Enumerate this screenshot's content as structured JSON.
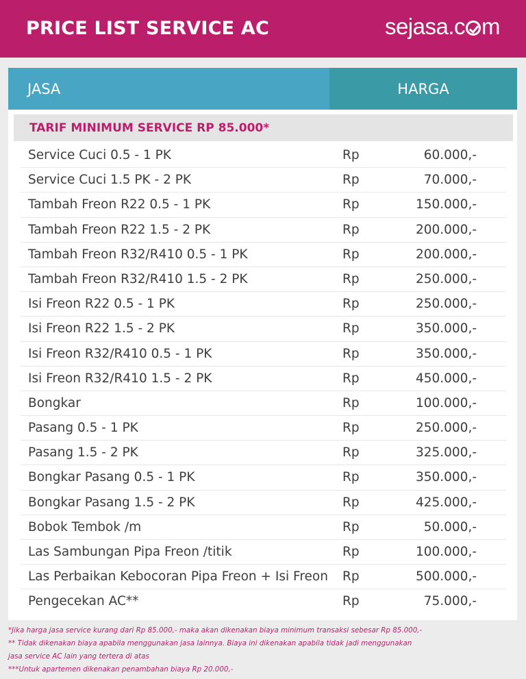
{
  "header": {
    "title": "PRICE LIST SERVICE AC",
    "logo_prefix": "sejasa.c",
    "logo_suffix": "m"
  },
  "table": {
    "col_jasa": "JASA",
    "col_harga": "HARGA",
    "tarif_minimum": "TARIF MINIMUM SERVICE RP 85.000*",
    "currency": "Rp",
    "rows": [
      {
        "name": "Service Cuci 0.5 - 1 PK",
        "price": "60.000,-"
      },
      {
        "name": "Service Cuci 1.5 PK - 2 PK",
        "price": "70.000,-"
      },
      {
        "name": "Tambah Freon R22 0.5 - 1 PK",
        "price": "150.000,-"
      },
      {
        "name": "Tambah Freon R22 1.5 - 2 PK",
        "price": "200.000,-"
      },
      {
        "name": "Tambah Freon R32/R410 0.5 - 1 PK",
        "price": "200.000,-"
      },
      {
        "name": "Tambah Freon R32/R410 1.5 - 2 PK",
        "price": "250.000,-"
      },
      {
        "name": "Isi Freon R22 0.5 - 1 PK",
        "price": "250.000,-"
      },
      {
        "name": "Isi Freon R22 1.5 - 2 PK",
        "price": "350.000,-"
      },
      {
        "name": "Isi Freon R32/R410 0.5 - 1 PK",
        "price": "350.000,-"
      },
      {
        "name": "Isi Freon R32/R410 1.5 - 2 PK",
        "price": "450.000,-"
      },
      {
        "name": "Bongkar",
        "price": "100.000,-"
      },
      {
        "name": "Pasang 0.5 - 1 PK",
        "price": "250.000,-"
      },
      {
        "name": "Pasang 1.5 - 2 PK",
        "price": "325.000,-"
      },
      {
        "name": "Bongkar Pasang 0.5 - 1 PK",
        "price": "350.000,-"
      },
      {
        "name": "Bongkar Pasang 1.5 - 2 PK",
        "price": "425.000,-"
      },
      {
        "name": "Bobok Tembok /m",
        "price": "50.000,-"
      },
      {
        "name": "Las Sambungan Pipa Freon /titik",
        "price": "100.000,-"
      },
      {
        "name": "Las Perbaikan Kebocoran Pipa Freon + Isi Freon",
        "price": "500.000,-"
      },
      {
        "name": "Pengecekan AC**",
        "price": "75.000,-"
      }
    ]
  },
  "notes": [
    "*Jika harga jasa service kurang dari Rp 85.000,- maka akan dikenakan biaya minimum transaksi sebesar Rp 85.000,-",
    "** Tidak dikenakan biaya apabila menggunakan jasa lainnya. Biaya ini dikenakan apabila tidak jadi menggunakan",
    "jasa service AC lain yang tertera di atas",
    "***Untuk apartemen dikenakan penambahan biaya Rp 20.000,-"
  ],
  "colors": {
    "brand": "#bb1f6b",
    "header_jasa": "#48a6c4",
    "header_harga": "#3a9aa6"
  }
}
